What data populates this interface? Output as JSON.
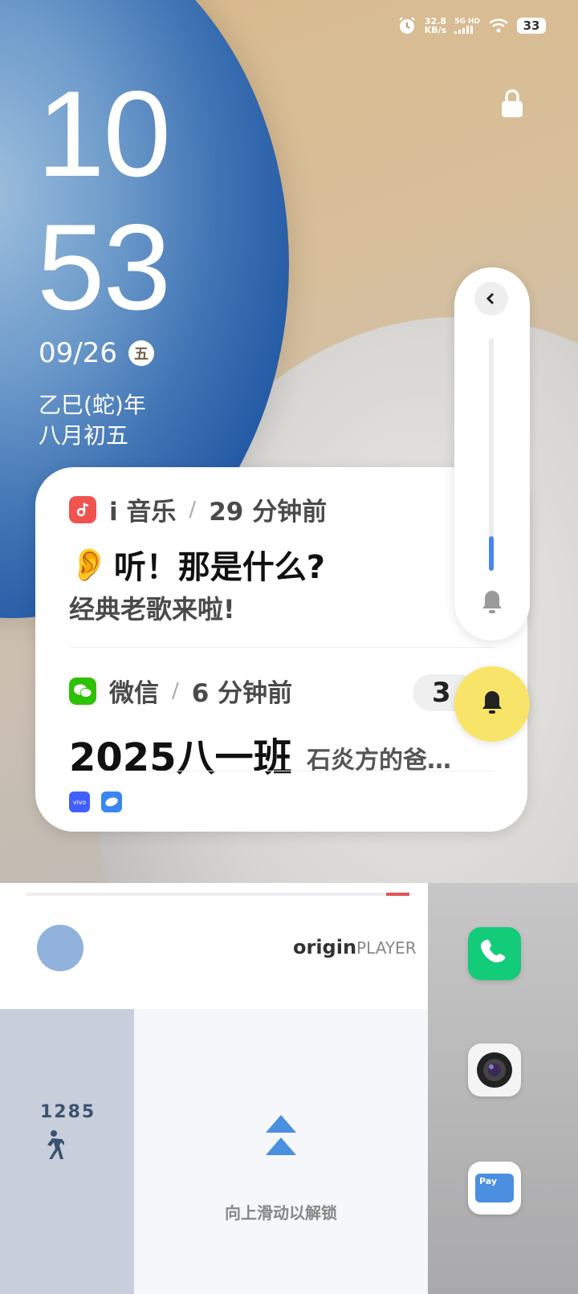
{
  "status": {
    "speed_value": "32.8",
    "speed_unit": "KB/s",
    "network": "5G HD",
    "battery": "33",
    "icons": [
      "alarm-icon",
      "signal-icon",
      "wifi-icon",
      "battery-icon"
    ]
  },
  "lockscreen": {
    "hour": "10",
    "minute": "53",
    "date": "09/26",
    "weekday": "五",
    "lunar_year": "乙巳(蛇)年",
    "lunar_day": "八月初五"
  },
  "notifications": [
    {
      "app": "i 音乐",
      "time": "29 分钟前",
      "emoji": "👂",
      "title": "听！那是什么?",
      "body": "经典老歌来啦!"
    },
    {
      "app": "微信",
      "time": "6 分钟前",
      "count": "3",
      "title": "2025八一班",
      "body": "石炎方的爸…"
    }
  ],
  "notification_sources": {
    "vivo_label": "vivo"
  },
  "volume": {
    "level_percent": 15
  },
  "player": {
    "brand_main": "origin",
    "brand_sub": "PLAYER",
    "progress_percent": 6
  },
  "steps": {
    "count": "1285"
  },
  "unlock": {
    "hint": "向上滑动以解锁"
  },
  "dock": {
    "apps": [
      "phone-icon",
      "camera-icon",
      "wallet-icon"
    ],
    "wallet_label": "Pay"
  },
  "colors": {
    "music_red": "#f0524f",
    "wechat_green": "#2dc100",
    "ring_yellow": "#f9e46a",
    "phone_green": "#2ecc71",
    "accent_blue": "#4a86e8"
  }
}
